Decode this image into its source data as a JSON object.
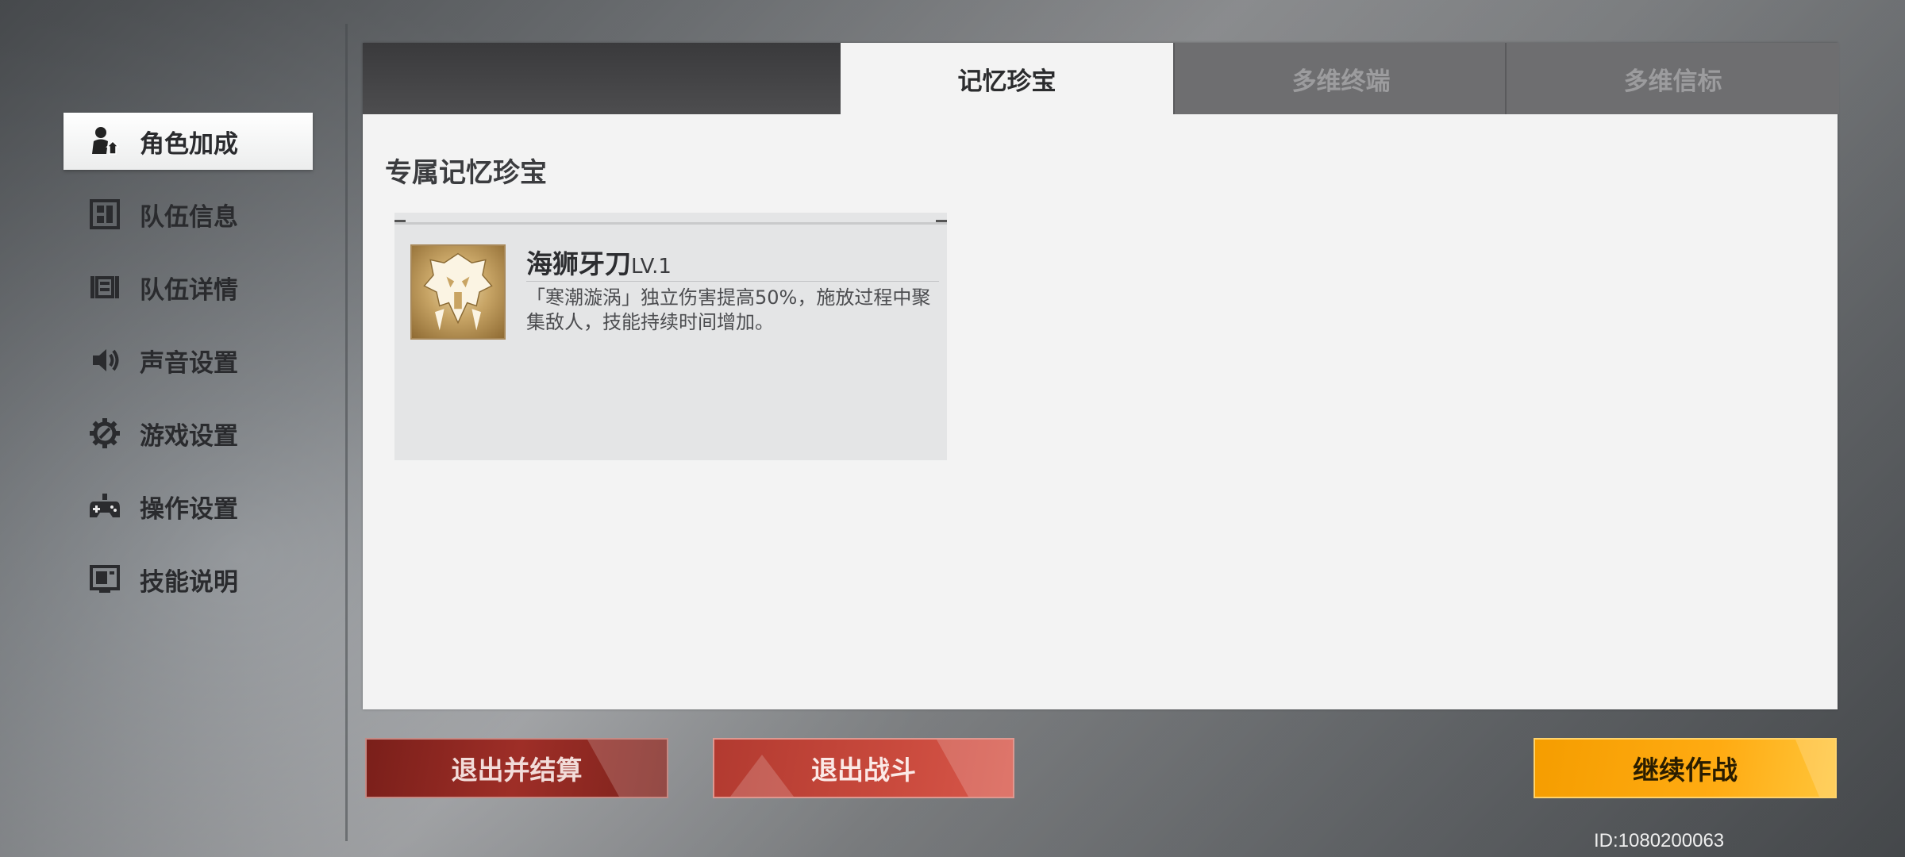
{
  "sidebar": {
    "items": [
      {
        "label": "角色加成",
        "icon": "character-bonus-icon",
        "active": true
      },
      {
        "label": "队伍信息",
        "icon": "team-info-icon",
        "active": false
      },
      {
        "label": "队伍详情",
        "icon": "team-details-icon",
        "active": false
      },
      {
        "label": "声音设置",
        "icon": "speaker-icon",
        "active": false
      },
      {
        "label": "游戏设置",
        "icon": "gear-icon",
        "active": false
      },
      {
        "label": "操作设置",
        "icon": "gamepad-icon",
        "active": false
      },
      {
        "label": "技能说明",
        "icon": "skill-screen-icon",
        "active": false
      }
    ]
  },
  "tabs": [
    {
      "label": "记忆珍宝",
      "active": true
    },
    {
      "label": "多维终端",
      "active": false
    },
    {
      "label": "多维信标",
      "active": false
    }
  ],
  "main": {
    "section_title": "专属记忆珍宝",
    "relic": {
      "name": "海狮牙刀",
      "level": "LV.1",
      "description": "「寒潮漩涡」独立伤害提高50%，施放过程中聚集敌人，技能持续时间增加。",
      "icon": "sea-lion-fang-emblem-icon"
    }
  },
  "buttons": {
    "exit_settle": "退出并结算",
    "exit_battle": "退出战斗",
    "continue": "继续作战"
  },
  "footer": {
    "id_text": "ID:1080200063"
  },
  "colors": {
    "exit_settle": "#8e2922",
    "exit_battle": "#c5473a",
    "continue": "#ffa50a",
    "panel_bg": "#f3f3f3"
  }
}
